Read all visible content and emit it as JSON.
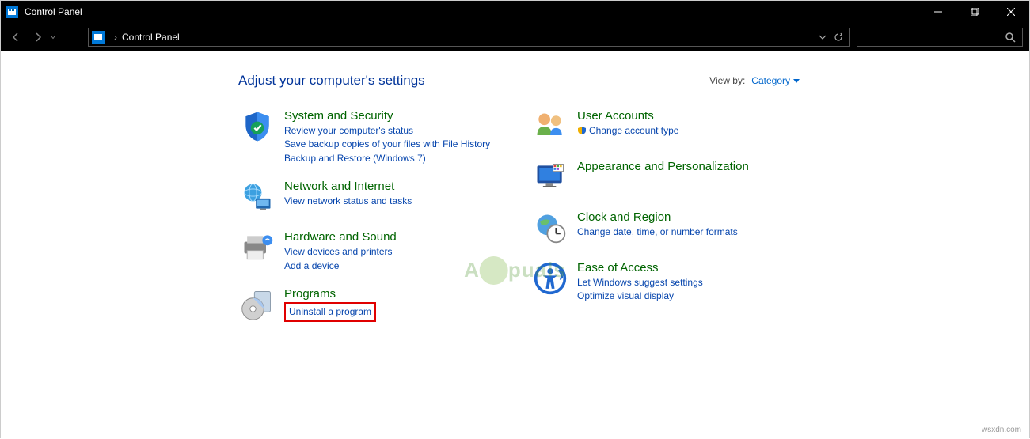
{
  "window": {
    "title": "Control Panel"
  },
  "address": {
    "location": "Control Panel"
  },
  "page": {
    "heading": "Adjust your computer's settings",
    "viewby_label": "View by:",
    "viewby_value": "Category"
  },
  "left_categories": [
    {
      "title": "System and Security",
      "links": [
        "Review your computer's status",
        "Save backup copies of your files with File History",
        "Backup and Restore (Windows 7)"
      ]
    },
    {
      "title": "Network and Internet",
      "links": [
        "View network status and tasks"
      ]
    },
    {
      "title": "Hardware and Sound",
      "links": [
        "View devices and printers",
        "Add a device"
      ]
    },
    {
      "title": "Programs",
      "links": [
        "Uninstall a program"
      ]
    }
  ],
  "right_categories": [
    {
      "title": "User Accounts",
      "links": [
        "Change account type"
      ]
    },
    {
      "title": "Appearance and Personalization",
      "links": []
    },
    {
      "title": "Clock and Region",
      "links": [
        "Change date, time, or number formats"
      ]
    },
    {
      "title": "Ease of Access",
      "links": [
        "Let Windows suggest settings",
        "Optimize visual display"
      ]
    }
  ],
  "watermark": "A   puals",
  "footer": "wsxdn.com"
}
